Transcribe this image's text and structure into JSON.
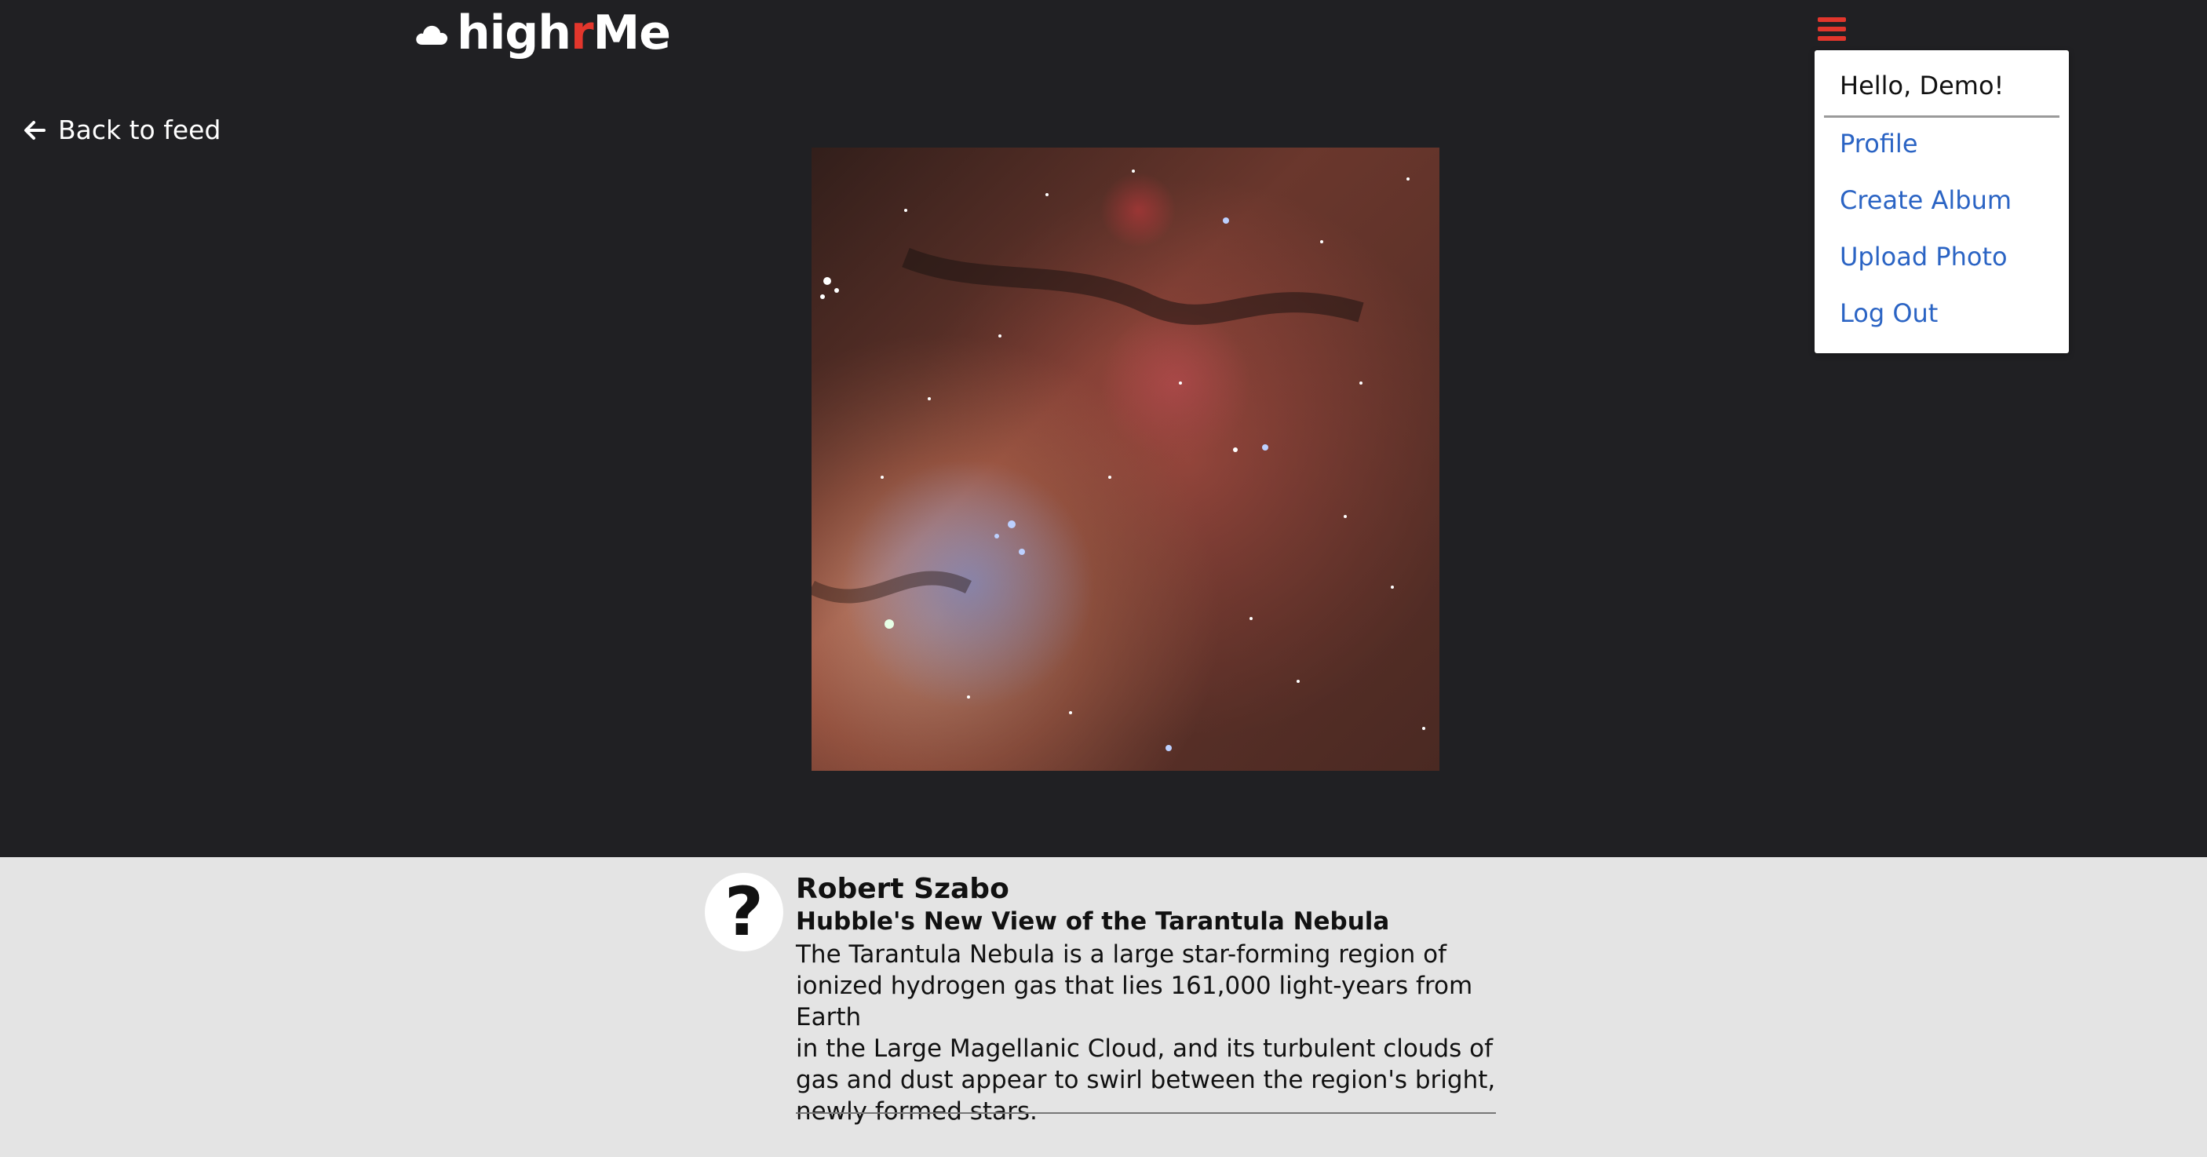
{
  "header": {
    "logo": {
      "prefix": "high",
      "accent": "r",
      "suffix": "Me"
    },
    "menu_icon": "hamburger-icon"
  },
  "user_menu": {
    "greeting": "Hello, Demo!",
    "items": [
      "Profile",
      "Create Album",
      "Upload Photo",
      "Log Out"
    ]
  },
  "nav": {
    "back_label": "Back to feed"
  },
  "photo": {
    "author": "Robert Szabo",
    "title": "Hubble's New View of the Tarantula Nebula",
    "description_lines": [
      "The Tarantula Nebula is a large star-forming region of",
      "ionized hydrogen gas that lies 161,000 light-years from Earth",
      "in the Large Magellanic Cloud, and its turbulent clouds of",
      "gas and dust appear to swirl between the region's bright,",
      "newly formed stars."
    ],
    "avatar_glyph": "?"
  },
  "colors": {
    "background_dark": "#202023",
    "background_light": "#e4e4e4",
    "accent": "#e2362c",
    "link": "#2b64c4"
  }
}
